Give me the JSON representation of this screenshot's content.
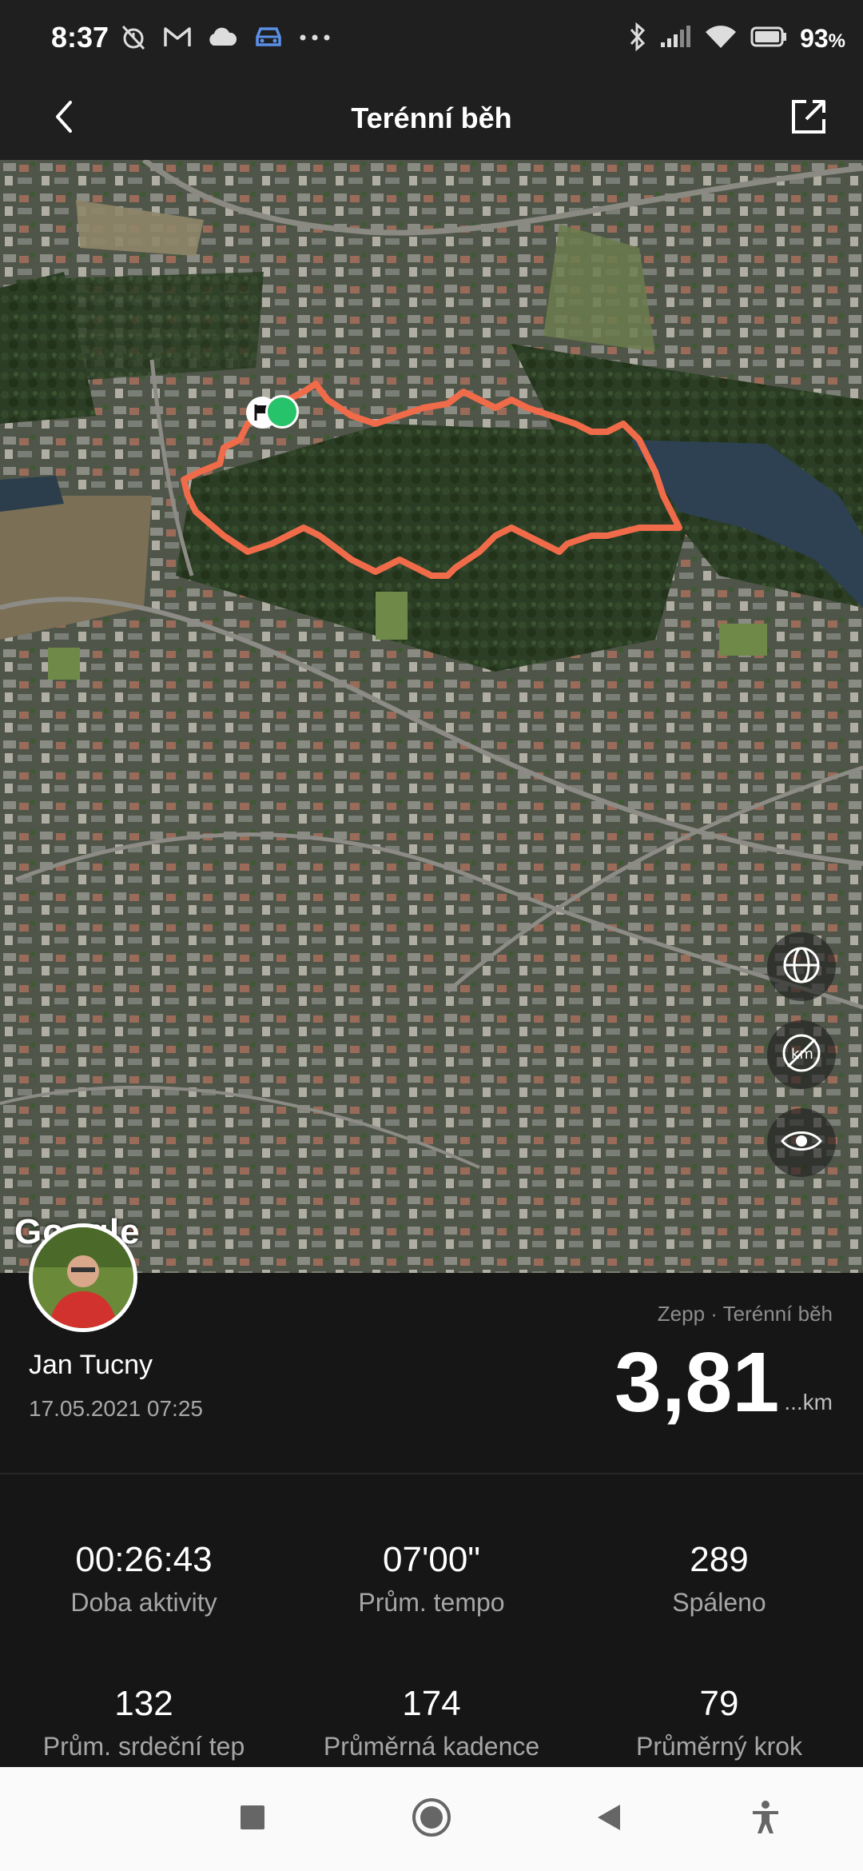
{
  "status_bar": {
    "time": "8:37",
    "battery_percent": "93",
    "battery_percent_suffix": "%",
    "icons_left": [
      "alarm-off-icon",
      "gmail-icon",
      "cloud-icon",
      "car-icon",
      "more-dots-icon"
    ],
    "icons_right": [
      "bluetooth-icon",
      "signal-icon",
      "wifi-icon",
      "battery-icon"
    ]
  },
  "header": {
    "title": "Terénní běh",
    "back_icon": "back-chevron-icon",
    "share_icon": "share-icon"
  },
  "map": {
    "attribution": "Google",
    "route_color": "#f06b4a",
    "start_marker_color": "#27c36a",
    "controls": [
      "globe-icon",
      "km-off-icon",
      "eye-icon"
    ]
  },
  "activity": {
    "user_name": "Jan Tucny",
    "date_time": "17.05.2021 07:25",
    "source": "Zepp · Terénní běh",
    "distance": "3,81",
    "distance_unit": "...km"
  },
  "stats": [
    {
      "value": "00:26:43",
      "label": "Doba aktivity"
    },
    {
      "value": "07'00\"",
      "label": "Prům. tempo"
    },
    {
      "value": "289",
      "label": "Spáleno"
    },
    {
      "value": "132",
      "label": "Prům. srdeční tep"
    },
    {
      "value": "174",
      "label": "Průměrná kadence"
    },
    {
      "value": "79",
      "label": "Průměrný krok"
    }
  ],
  "nav_bar": {
    "buttons": [
      "recents-square-icon",
      "home-circle-icon",
      "back-triangle-icon",
      "accessibility-icon"
    ]
  },
  "colors": {
    "background": "#141414",
    "header": "#1f1f1f",
    "accent_route": "#f06b4a"
  }
}
